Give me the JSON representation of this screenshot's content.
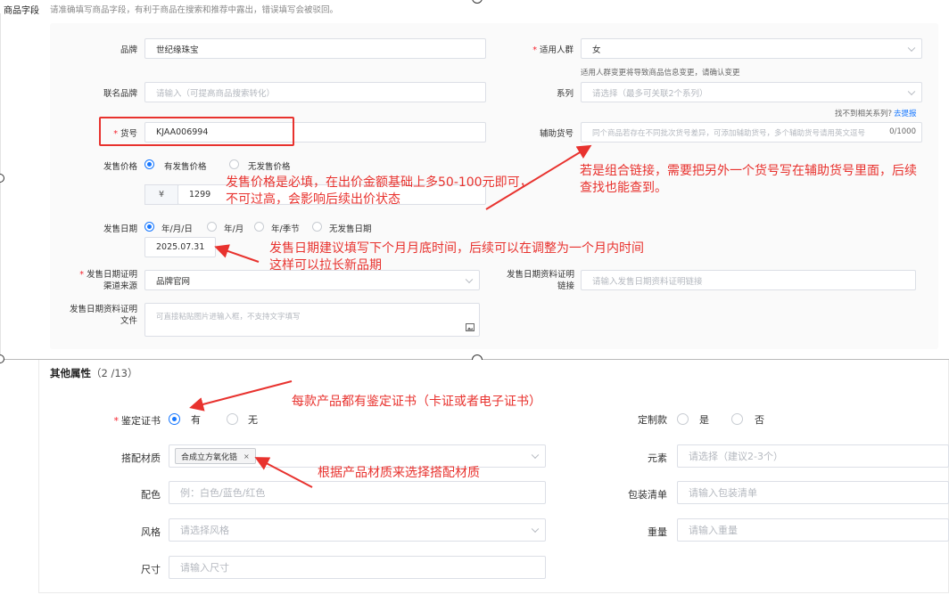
{
  "header": {
    "title": "商品字段",
    "subtitle": "请准确填写商品字段，有利于商品在搜索和推荐中露出，错误填写会被驳回。"
  },
  "fields": {
    "brand": {
      "label": "品牌",
      "value": "世纪缘珠宝"
    },
    "audience": {
      "label": "适用人群",
      "value": "女",
      "hint": "适用人群变更将导致商品信息变更，请确认变更"
    },
    "co_brand": {
      "label": "联名品牌",
      "placeholder": "请输入（可提高商品搜索转化）"
    },
    "series": {
      "label": "系列",
      "placeholder": "请选择（最多可关联2个系列）",
      "hint": "找不到相关系列?",
      "hint_link": "去提报"
    },
    "sku": {
      "label": "货号",
      "value": "KJAA006994"
    },
    "aux_sku": {
      "label": "辅助货号",
      "placeholder": "同个商品若存在不同批次货号差异，可添加辅助货号，多个辅助货号请用英文逗号",
      "counter": "0/1000"
    },
    "price": {
      "label": "发售价格",
      "opt_yes": "有发售价格",
      "opt_no": "无发售价格",
      "currency": "¥",
      "value": "1299"
    },
    "release_date": {
      "label": "发售日期",
      "opt1": "年/月/日",
      "opt2": "年/月",
      "opt3": "年/季节",
      "opt4": "无发售日期",
      "value": "2025.07.31"
    },
    "proof_source": {
      "label": "发售日期证明渠道来源",
      "value": "品牌官网"
    },
    "proof_link": {
      "label": "发售日期资料证明链接",
      "placeholder": "请输入发售日期资料证明链接"
    },
    "proof_file": {
      "label": "发售日期资料证明文件",
      "placeholder": "可直接粘贴图片进输入框，不支持文字填写"
    }
  },
  "other": {
    "title": "其他属性",
    "count": "（2 /13）",
    "cert": {
      "label": "鉴定证书",
      "opt_yes": "有",
      "opt_no": "无"
    },
    "custom": {
      "label": "定制款",
      "opt_yes": "是",
      "opt_no": "否"
    },
    "material": {
      "label": "搭配材质",
      "tag": "合成立方氧化锆"
    },
    "element": {
      "label": "元素",
      "placeholder": "请选择（建议2-3个）"
    },
    "color": {
      "label": "配色",
      "placeholder": "例：白色/蓝色/红色"
    },
    "package": {
      "label": "包装清单",
      "placeholder": "请输入包装清单"
    },
    "style": {
      "label": "风格",
      "placeholder": "请选择风格"
    },
    "weight": {
      "label": "重量",
      "placeholder": "请输入重量"
    },
    "size": {
      "label": "尺寸",
      "placeholder": "请输入尺寸"
    }
  },
  "annotations": {
    "price_note_1": "发售价格是必填，在出价金额基础上多50-100元即可，",
    "price_note_2": "不可过高，会影响后续出价状态",
    "aux_note_1": "若是组合链接，需要把另外一个货号写在辅助货号里面，后续",
    "aux_note_2": "查找也能查到。",
    "date_note_1": "发售日期建议填写下个月月底时间，后续可以在调整为一个月内时间",
    "date_note_2": "这样可以拉长新品期",
    "cert_note": "每款产品都有鉴定证书（卡证或者电子证书）",
    "material_note": "根据产品材质来选择搭配材质"
  },
  "colors": {
    "accent": "#1677ff",
    "annotation": "#e8322e",
    "required": "#f5222d"
  }
}
